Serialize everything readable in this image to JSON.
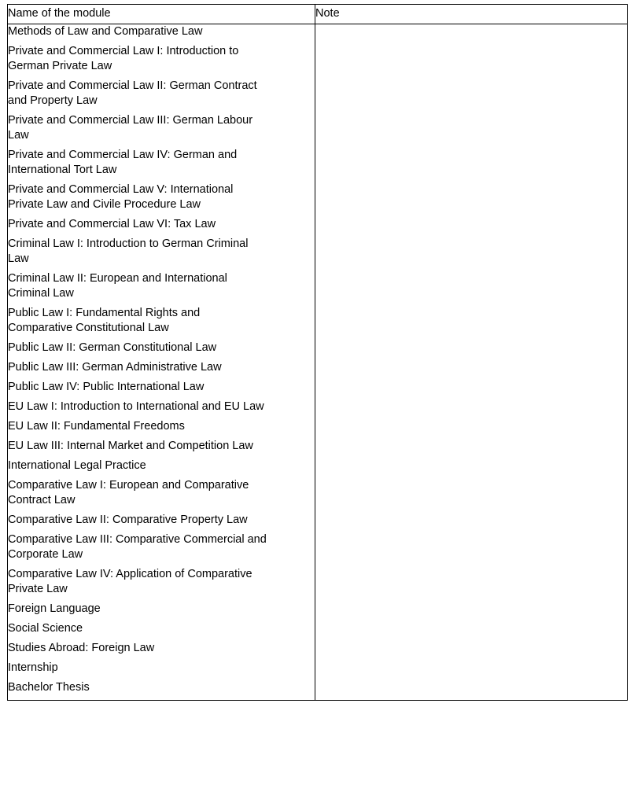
{
  "table": {
    "headers": {
      "module": "Name of the module",
      "note": "Note"
    },
    "rows": [
      {
        "module": "Methods of Law and Comparative Law",
        "note": ""
      },
      {
        "module": "Private and Commercial Law I: Introduction to\nGerman Private Law",
        "note": ""
      },
      {
        "module": "Private and Commercial Law II: German Contract\nand Property Law",
        "note": ""
      },
      {
        "module": "Private and Commercial Law III: German Labour\nLaw",
        "note": ""
      },
      {
        "module": "Private and Commercial Law IV: German and\nInternational Tort Law",
        "note": ""
      },
      {
        "module": "Private and Commercial Law V: International\nPrivate Law and Civile Procedure Law",
        "note": ""
      },
      {
        "module": "Private and Commercial Law VI: Tax Law",
        "note": ""
      },
      {
        "module": "Criminal Law I: Introduction to German Criminal\nLaw",
        "note": ""
      },
      {
        "module": "Criminal Law II: European and International\nCriminal Law",
        "note": ""
      },
      {
        "module": "Public Law I: Fundamental Rights and\nComparative Constitutional Law",
        "note": ""
      },
      {
        "module": "Public Law II: German Constitutional Law",
        "note": ""
      },
      {
        "module": "Public Law III: German Administrative Law",
        "note": ""
      },
      {
        "module": "Public Law IV: Public International Law",
        "note": ""
      },
      {
        "module": "EU Law I: Introduction to International and EU Law",
        "note": ""
      },
      {
        "module": "EU Law II: Fundamental Freedoms",
        "note": ""
      },
      {
        "module": "EU Law III: Internal Market and Competition Law",
        "note": ""
      },
      {
        "module": "International Legal Practice",
        "note": ""
      },
      {
        "module": "Comparative Law I: European and Comparative\nContract Law",
        "note": ""
      },
      {
        "module": "Comparative Law II: Comparative Property Law",
        "note": ""
      },
      {
        "module": "Comparative Law III: Comparative Commercial and\nCorporate Law",
        "note": ""
      },
      {
        "module": "Comparative Law IV: Application of Comparative\nPrivate Law",
        "note": ""
      },
      {
        "module": "Foreign Language",
        "note": ""
      },
      {
        "module": "Social Science",
        "note": ""
      },
      {
        "module": "Studies Abroad: Foreign Law",
        "note": ""
      },
      {
        "module": "Internship",
        "note": ""
      },
      {
        "module": "Bachelor Thesis",
        "note": ""
      }
    ]
  },
  "colors": {
    "text": "#000000",
    "border": "#000000",
    "background": "#ffffff"
  }
}
